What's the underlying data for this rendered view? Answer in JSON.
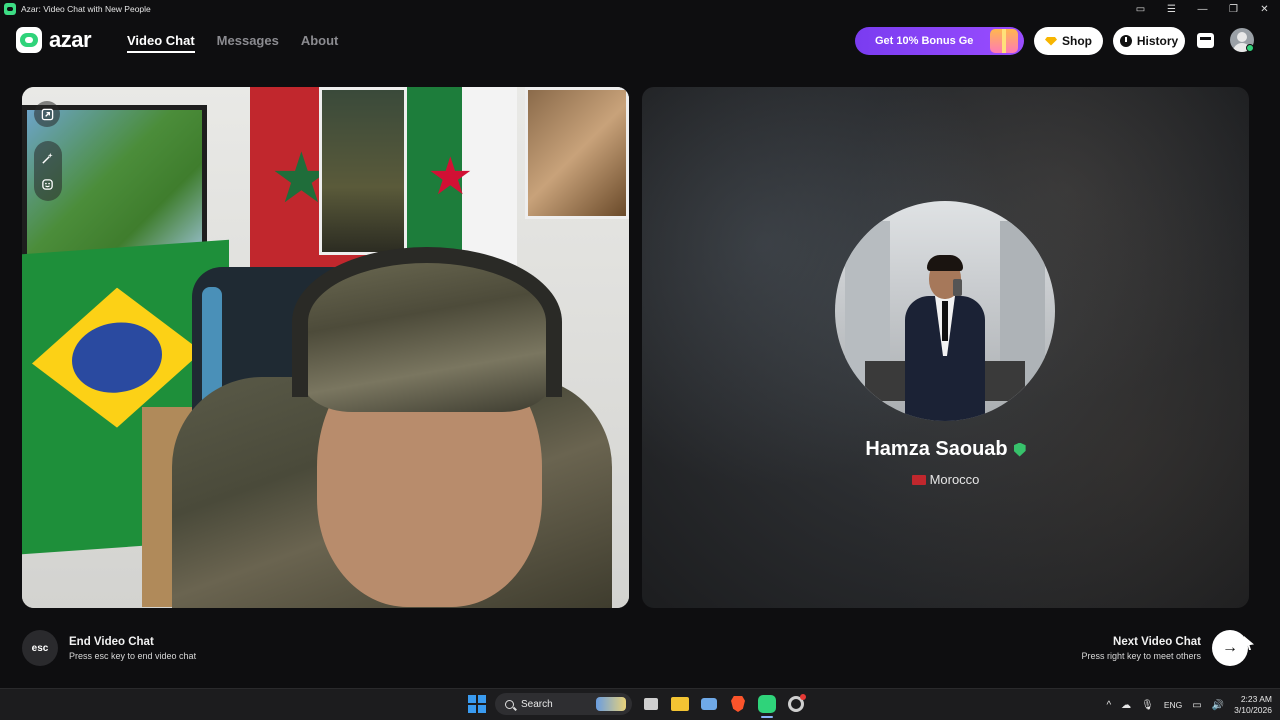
{
  "window": {
    "title": "Azar: Video Chat with New People",
    "controls": {
      "cast": "▭",
      "menu": "☰",
      "minimize": "—",
      "restore": "❐",
      "close": "✕"
    }
  },
  "header": {
    "logo_text": "azar",
    "nav": [
      {
        "label": "Video Chat",
        "active": true
      },
      {
        "label": "Messages",
        "active": false
      },
      {
        "label": "About",
        "active": false
      }
    ],
    "bonus_label": "Get 10% Bonus Ge",
    "shop_label": "Shop",
    "history_label": "History"
  },
  "remote": {
    "name": "Hamza Saouab",
    "country": "Morocco",
    "verified": true
  },
  "footer": {
    "esc_key": "esc",
    "end_title": "End Video Chat",
    "end_hint": "Press esc key to end video chat",
    "next_title": "Next Video Chat",
    "next_hint": "Press right key to meet others",
    "next_arrow": "→"
  },
  "taskbar": {
    "search_label": "Search",
    "tray_chevron": "^",
    "language": "ENG",
    "time": "2:23 AM",
    "date": "3/10/2026"
  },
  "colors": {
    "background": "#0e0e10",
    "accent_green": "#2fd37a",
    "bonus_purple": "#7a3cf0",
    "verified_green": "#37c26b"
  }
}
